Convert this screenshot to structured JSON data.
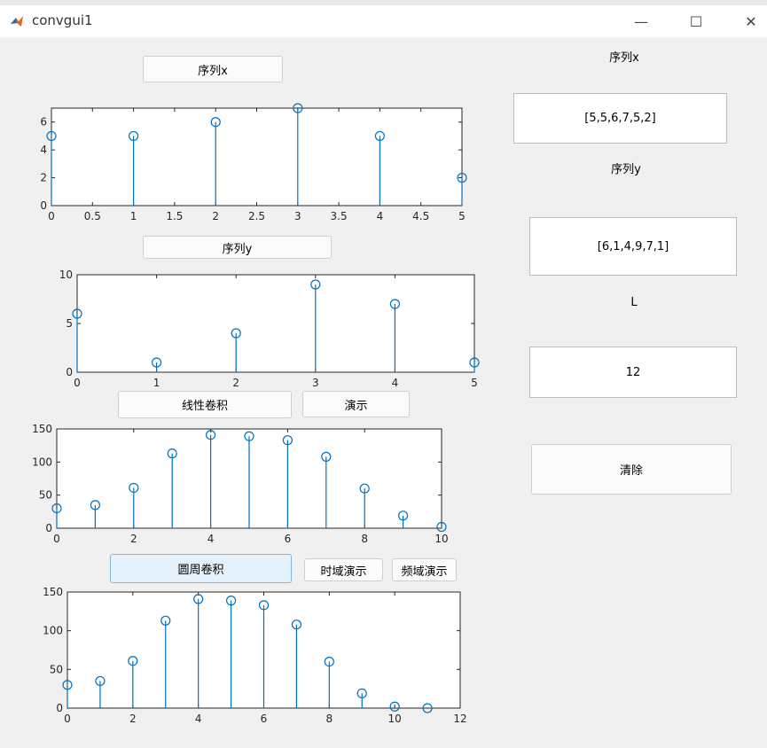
{
  "window": {
    "title": "convgui1",
    "icon": "matlab-icon",
    "controls": {
      "minimize": "—",
      "maximize": "☐",
      "close": "✕"
    }
  },
  "buttons": {
    "seq_x": "序列x",
    "seq_y": "序列y",
    "linear_conv": "线性卷积",
    "demo": "演示",
    "circular_conv": "圆周卷积",
    "time_demo": "时域演示",
    "freq_demo": "频域演示",
    "clear": "清除"
  },
  "panel": {
    "label_x": "序列x",
    "value_x": "[5,5,6,7,5,2]",
    "label_y": "序列y",
    "value_y": "[6,1,4,9,7,1]",
    "label_L": "L",
    "value_L": "12"
  },
  "colors": {
    "stem": "#0072bd",
    "axes": "#262626",
    "window_bg": "#f0f0f0",
    "active_button": "#e5f1fb"
  },
  "chart_data": [
    {
      "type": "stem",
      "x": [
        0,
        1,
        2,
        3,
        4,
        5
      ],
      "y": [
        5,
        5,
        6,
        7,
        5,
        2
      ],
      "xlim": [
        0,
        5
      ],
      "ylim": [
        0,
        7
      ],
      "xticks": [
        0,
        0.5,
        1,
        1.5,
        2,
        2.5,
        3,
        3.5,
        4,
        4.5,
        5
      ],
      "xtick_labels": [
        "0",
        "0.5",
        "1",
        "1.5",
        "2",
        "2.5",
        "3",
        "3.5",
        "4",
        "4.5",
        "5"
      ],
      "yticks": [
        0,
        2,
        4,
        6
      ],
      "ytick_labels": [
        "0",
        "2",
        "4",
        "6"
      ]
    },
    {
      "type": "stem",
      "x": [
        0,
        1,
        2,
        3,
        4,
        5
      ],
      "y": [
        6,
        1,
        4,
        9,
        7,
        1
      ],
      "xlim": [
        0,
        5
      ],
      "ylim": [
        0,
        10
      ],
      "xticks": [
        0,
        1,
        2,
        3,
        4,
        5
      ],
      "xtick_labels": [
        "0",
        "1",
        "2",
        "3",
        "4",
        "5"
      ],
      "yticks": [
        0,
        5,
        10
      ],
      "ytick_labels": [
        "0",
        "5",
        "10"
      ]
    },
    {
      "type": "stem",
      "x": [
        0,
        1,
        2,
        3,
        4,
        5,
        6,
        7,
        8,
        9,
        10
      ],
      "y": [
        30,
        35,
        61,
        113,
        141,
        139,
        133,
        108,
        60,
        19,
        2
      ],
      "xlim": [
        0,
        10
      ],
      "ylim": [
        0,
        150
      ],
      "xticks": [
        0,
        2,
        4,
        6,
        8,
        10
      ],
      "xtick_labels": [
        "0",
        "2",
        "4",
        "6",
        "8",
        "10"
      ],
      "yticks": [
        0,
        50,
        100,
        150
      ],
      "ytick_labels": [
        "0",
        "50",
        "100",
        "150"
      ]
    },
    {
      "type": "stem",
      "x": [
        0,
        1,
        2,
        3,
        4,
        5,
        6,
        7,
        8,
        9,
        10,
        11
      ],
      "y": [
        30,
        35,
        61,
        113,
        141,
        139,
        133,
        108,
        60,
        19,
        2,
        0
      ],
      "xlim": [
        0,
        12
      ],
      "ylim": [
        0,
        150
      ],
      "xticks": [
        0,
        2,
        4,
        6,
        8,
        10,
        12
      ],
      "xtick_labels": [
        "0",
        "2",
        "4",
        "6",
        "8",
        "10",
        "12"
      ],
      "yticks": [
        0,
        50,
        100,
        150
      ],
      "ytick_labels": [
        "0",
        "50",
        "100",
        "150"
      ]
    }
  ]
}
